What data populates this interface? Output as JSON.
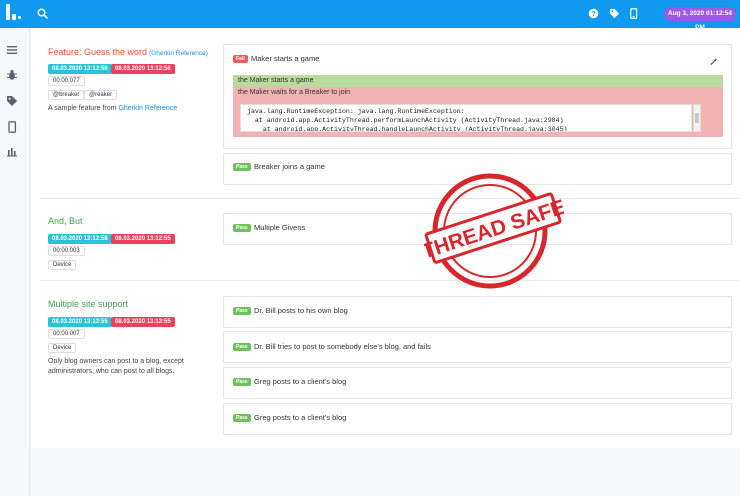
{
  "header": {
    "date": "Aug 3, 2020 01:12:54 PM",
    "icons": [
      "search-icon",
      "help-icon",
      "tag-icon",
      "device-icon"
    ]
  },
  "sidebar": {
    "items": [
      "list-icon",
      "bug-icon",
      "tag-icon",
      "device-icon",
      "chart-icon"
    ]
  },
  "features": [
    {
      "title": "Feature: Guess the word",
      "reference_label": "(Gherkin Reference)",
      "start": "08.03.2020 13:12:56",
      "end": "08.03.2020 13:12:56",
      "duration": "00:00.077",
      "tags": [
        "@breaker",
        "@reaker"
      ],
      "description_prefix": "A sample feature from",
      "description_link": "Gherkin Reference",
      "scenarios": [
        {
          "status": "Fail",
          "title": "Maker starts a game",
          "steps": [
            {
              "status": "pass",
              "text": "the Maker starts a game"
            },
            {
              "status": "fail",
              "text": "the Maker waits for a Breaker to join"
            }
          ],
          "stack_trace": "java.lang.RuntimeException: java.lang.RuntimeException:\n  at android.app.ActivityThread.performLaunchActivity (ActivityThread.java:2984)\n    at android.app.ActivityThread.handleLaunchActivity (ActivityThread.java:3045)"
        },
        {
          "status": "Pass",
          "title": "Breaker joins a game"
        }
      ]
    },
    {
      "title": "And, But",
      "start": "08.03.2020 13:12:58",
      "end": "08.03.2020 13:12:55",
      "duration": "00:00.003",
      "tags": [
        "Device"
      ],
      "scenarios": [
        {
          "status": "Pass",
          "title": "Multiple Givens"
        }
      ]
    },
    {
      "title": "Multiple site support",
      "start": "08.03.2020 13:12:55",
      "end": "08.03.2020 13:12:55",
      "duration": "00:00.007",
      "tags": [
        "Device"
      ],
      "description": "Only blog owners can post to a blog, except administrators, who can post to all blogs.",
      "scenarios": [
        {
          "status": "Pass",
          "title": "Dr. Bill posts to his own blog"
        },
        {
          "status": "Pass",
          "title": "Dr. Bill tries to post to somebody else's blog, and fails"
        },
        {
          "status": "Pass",
          "title": "Greg posts to a client's blog"
        },
        {
          "status": "Pass",
          "title": "Greg posts to a client's blog"
        }
      ]
    }
  ],
  "stamp": {
    "text": "THREAD SAFE",
    "color": "#d8262c"
  },
  "colors": {
    "topbar": "#0f9af0",
    "pass": "#6fbf5a",
    "fail": "#f2585f",
    "start_badge": "#27c6d7",
    "end_badge": "#ef3f5c",
    "date_pill": "#9b59e6"
  }
}
